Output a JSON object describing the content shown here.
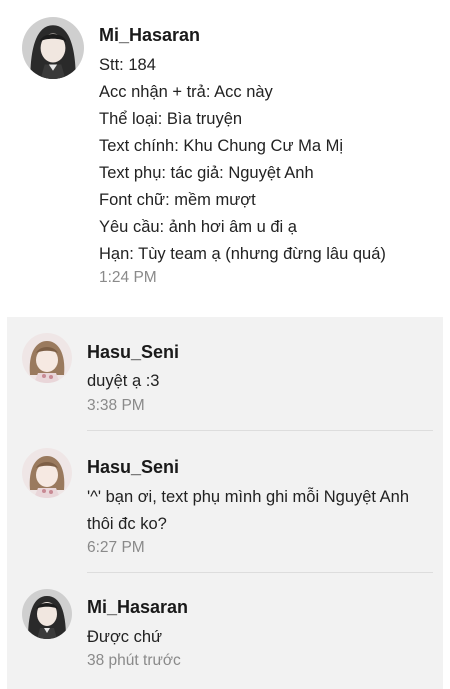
{
  "thread": {
    "main": {
      "username": "Mi_Hasaran",
      "avatar_icon": "anime-girl-avatar-icon",
      "lines": [
        "Stt: 184",
        "Acc nhận + trả: Acc này",
        "Thể loại: Bìa truyện",
        "Text chính: Khu Chung Cư Ma Mị",
        "Text phụ: tác giả: Nguyệt Anh",
        "Font chữ: mềm mượt",
        "Yêu cầu: ảnh hơi âm u đi ạ",
        "Hạn: Tùy team ạ (nhưng đừng lâu quá)"
      ],
      "time": "1:24 PM"
    },
    "replies": [
      {
        "username": "Hasu_Seni",
        "avatar_icon": "anime-girl-brown-hair-avatar-icon",
        "lines": [
          "duyệt ạ :3"
        ],
        "time": "3:38 PM"
      },
      {
        "username": "Hasu_Seni",
        "avatar_icon": "anime-girl-brown-hair-avatar-icon",
        "lines": [
          "'^' bạn ơi, text phụ mình ghi mỗi Nguyệt Anh",
          "thôi đc ko?"
        ],
        "time": "6:27 PM"
      },
      {
        "username": "Mi_Hasaran",
        "avatar_icon": "anime-girl-avatar-icon",
        "lines": [
          "Được chứ"
        ],
        "time": "38 phút trước"
      }
    ]
  }
}
